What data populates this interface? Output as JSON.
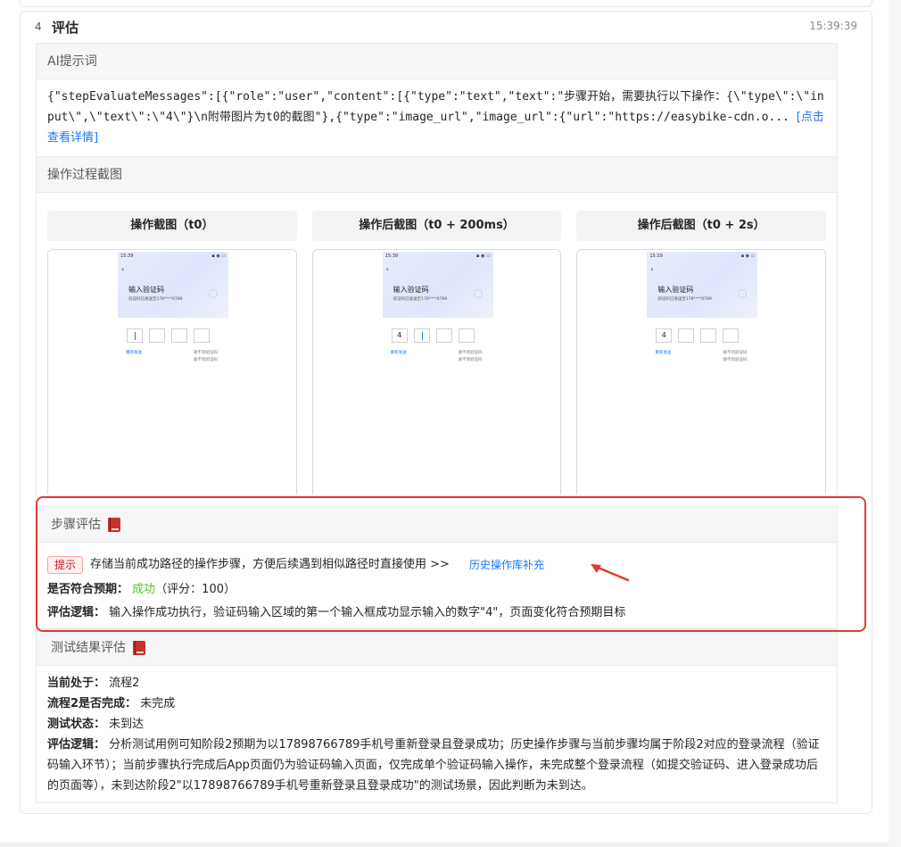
{
  "step": {
    "index": "4",
    "title": "评估",
    "time": "15:39:39"
  },
  "prompt": {
    "title": "AI提示词",
    "text": "{\"stepEvaluateMessages\":[{\"role\":\"user\",\"content\":[{\"type\":\"text\",\"text\":\"步骤开始，需要执行以下操作：{\\\"type\\\":\\\"input\\\",\\\"text\\\":\\\"4\\\"}\\n附带图片为t0的截图\"},{\"type\":\"image_url\",\"image_url\":{\"url\":\"https://easybike-cdn.o...",
    "detail_link": "[点击查看详情]"
  },
  "screenshots": {
    "title": "操作过程截图",
    "items": [
      {
        "label": "操作截图（t0）",
        "codes": [
          "",
          "",
          "",
          ""
        ],
        "cursor_index": 0
      },
      {
        "label": "操作后截图（t0 + 200ms）",
        "codes": [
          "4",
          "",
          "",
          ""
        ],
        "cursor_index": 1
      },
      {
        "label": "操作后截图（t0 + 2s）",
        "codes": [
          "4",
          "",
          "",
          ""
        ],
        "cursor_index": -1
      }
    ],
    "phone": {
      "status_time": "15:39",
      "status_right": "▪ ◉ ▭",
      "back": "‹",
      "title": "输入验证码",
      "subtitle": "验证码已发送至178****6789",
      "resend": "重新发送",
      "novoice": "收不到验证码",
      "novoice2": "收不到验证码"
    }
  },
  "step_eval": {
    "title": "步骤评估",
    "tip_tag": "提示",
    "tip_text": "存储当前成功路径的操作步骤，方便后续遇到相似路径时直接使用 >>",
    "tip_link": "历史操作库补充",
    "expected_label": "是否符合预期：",
    "expected_value": "成功",
    "score": "（评分：100）",
    "logic_label": "评估逻辑：",
    "logic_text": "输入操作成功执行，验证码输入区域的第一个输入框成功显示输入的数字\"4\"，页面变化符合预期目标"
  },
  "test_eval": {
    "title": "测试结果评估",
    "current_label": "当前处于：",
    "current_value": "流程2",
    "done_label": "流程2是否完成：",
    "done_value": "未完成",
    "state_label": "测试状态：",
    "state_value": "未到达",
    "logic_label": "评估逻辑：",
    "logic_text": "分析测试用例可知阶段2预期为以17898766789手机号重新登录且登录成功；历史操作步骤与当前步骤均属于阶段2对应的登录流程（验证码输入环节）；当前步骤执行完成后App页面仍为验证码输入页面，仅完成单个验证码输入操作，未完成整个登录流程（如提交验证码、进入登录成功后的页面等），未到达阶段2\"以17898766789手机号重新登录且登录成功\"的测试场景，因此判断为未到达。"
  },
  "colors": {
    "accent": "#1677ff",
    "success": "#52c41a",
    "highlight": "#e53935",
    "tag_red": "#cf1322"
  }
}
